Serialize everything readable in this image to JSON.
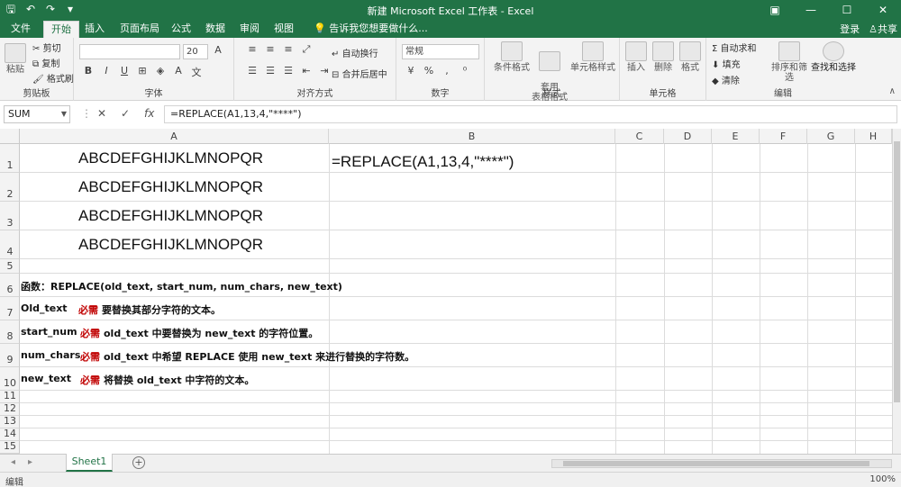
{
  "window": {
    "title": "新建 Microsoft Excel 工作表 - Excel"
  },
  "tabs": {
    "items": [
      "文件",
      "开始",
      "插入",
      "页面布局",
      "公式",
      "数据",
      "审阅",
      "视图"
    ],
    "active": "开始",
    "tellme": "告诉我您想要做什么...",
    "login": "登录",
    "share": "共享"
  },
  "ribbon": {
    "clipboard": {
      "label": "剪贴板",
      "paste": "粘贴",
      "cut": "剪切",
      "copy": "复制",
      "format_painter": "格式刷"
    },
    "font": {
      "label": "字体",
      "size": "20"
    },
    "alignment": {
      "label": "对齐方式",
      "wrap": "自动换行",
      "merge": "合并后居中"
    },
    "number": {
      "label": "数字",
      "format": "常规"
    },
    "styles": {
      "label": "样式",
      "conditional": "条件格式",
      "table": "套用\n表格格式",
      "cell_styles": "单元格样式"
    },
    "cells": {
      "label": "单元格",
      "insert": "插入",
      "delete": "删除",
      "format": "格式"
    },
    "editing": {
      "label": "编辑",
      "autosum": "自动求和",
      "fill": "填充",
      "clear": "清除",
      "sort": "排序和筛选",
      "find": "查找和选择"
    }
  },
  "formula_bar": {
    "name_box": "SUM",
    "fx": "fx",
    "formula": "=REPLACE(A1,13,4,\"****\")"
  },
  "grid": {
    "columns": [
      "A",
      "B",
      "C",
      "D",
      "E",
      "F",
      "G",
      "H"
    ],
    "rows": [
      "1",
      "2",
      "3",
      "4",
      "5",
      "6",
      "7",
      "8",
      "9",
      "10",
      "11",
      "12",
      "13",
      "14",
      "15"
    ],
    "cells": {
      "a1": "ABCDEFGHIJKLMNOPQR",
      "a2": "ABCDEFGHIJKLMNOPQR",
      "a3": "ABCDEFGHIJKLMNOPQR",
      "a4": "ABCDEFGHIJKLMNOPQR",
      "b1": "=REPLACE(A1,13,4,\"****\")",
      "a6": "函数：REPLACE(old_text, start_num, num_chars, new_text)",
      "a7_name": "Old_text",
      "a7_req": "必需",
      "a7_text": "要替换其部分字符的文本。",
      "a8_name": "start_num",
      "a8_req": "必需",
      "a8_text": "old_text 中要替换为 new_text 的字符位置。",
      "a9_name": "num_chars",
      "a9_req": "必需",
      "a9_text": "old_text 中希望 REPLACE 使用 new_text 来进行替换的字符数。",
      "a10_name": "new_text",
      "a10_req": "必需",
      "a10_text": "将替换 old_text 中字符的文本。"
    }
  },
  "sheets": {
    "active": "Sheet1"
  },
  "status": {
    "mode": "编辑",
    "zoom": "100%"
  }
}
